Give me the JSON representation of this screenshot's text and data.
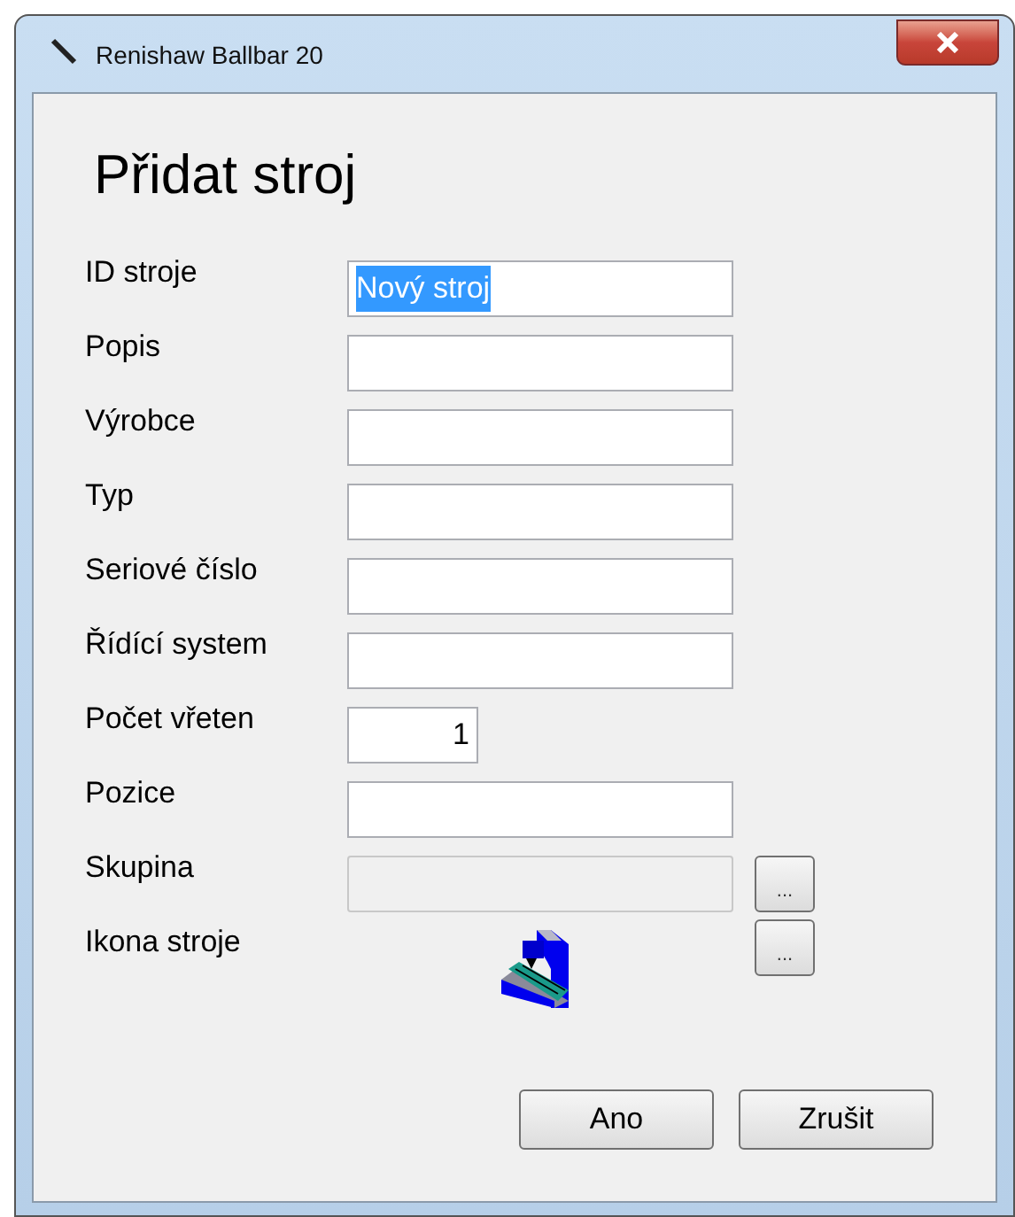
{
  "window": {
    "title": "Renishaw Ballbar 20"
  },
  "heading": "Přidat stroj",
  "fields": [
    {
      "kind": "text",
      "label": "ID stroje",
      "value": "Nový stroj",
      "highlighted": true
    },
    {
      "kind": "text",
      "label": "Popis"
    },
    {
      "kind": "text",
      "label": "Výrobce"
    },
    {
      "kind": "text",
      "label": "Typ"
    },
    {
      "kind": "text",
      "label": "Seriové číslo"
    },
    {
      "kind": "text",
      "label": "Řídící system"
    },
    {
      "kind": "number",
      "label": "Počet vřeten",
      "value": "1"
    },
    {
      "kind": "text",
      "label": "Pozice"
    },
    {
      "kind": "browse",
      "label": "Skupina",
      "disabled": true,
      "button": "..."
    },
    {
      "kind": "icon",
      "label": "Ikona stroje",
      "button": "..."
    }
  ],
  "buttons": [
    "Ano",
    "Zrušit"
  ]
}
